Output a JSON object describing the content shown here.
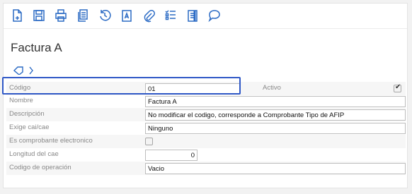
{
  "page": {
    "title": "Factura A"
  },
  "toolbar": {
    "buttons": [
      {
        "name": "new-document-button",
        "icon": "new-document-icon"
      },
      {
        "name": "save-button",
        "icon": "save-icon"
      },
      {
        "name": "print-button",
        "icon": "print-icon"
      },
      {
        "name": "copy-button",
        "icon": "copy-icon"
      },
      {
        "name": "history-button",
        "icon": "history-icon"
      },
      {
        "name": "text-field-button",
        "icon": "text-field-icon"
      },
      {
        "name": "attach-button",
        "icon": "paperclip-icon"
      },
      {
        "name": "checklist-button",
        "icon": "checklist-icon"
      },
      {
        "name": "view-button",
        "icon": "document-view-icon"
      },
      {
        "name": "comment-button",
        "icon": "comment-icon"
      }
    ]
  },
  "form": {
    "codigo": {
      "label": "Código",
      "value": "01"
    },
    "activo": {
      "label": "Activo",
      "checked": true
    },
    "nombre": {
      "label": "Nombre",
      "value": "Factura A"
    },
    "descripcion": {
      "label": "Descripción",
      "value": "No modificar el codigo, corresponde a Comprobante Tipo de AFIP"
    },
    "exige_cai": {
      "label": "Exige cai/cae",
      "value": "Ninguno"
    },
    "es_comprobante": {
      "label": "Es comprobante electronico",
      "checked": false
    },
    "longitud_cae": {
      "label": "Longitud del cae",
      "value": "0"
    },
    "codigo_operacion": {
      "label": "Codigo de operación",
      "value": "Vacio"
    }
  },
  "colors": {
    "accent": "#2a6ac4",
    "focus": "#2f58c6"
  }
}
